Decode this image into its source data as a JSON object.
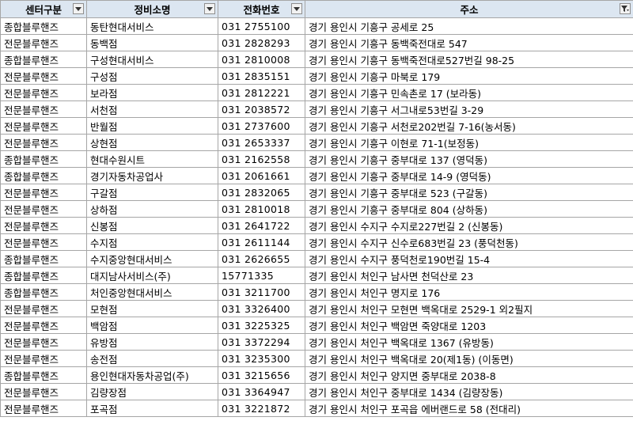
{
  "headers": [
    "센터구분",
    "정비소명",
    "전화번호",
    "주소"
  ],
  "header_filters": [
    "chevron-down-icon",
    "chevron-down-icon",
    "chevron-down-icon",
    "filter-active-icon"
  ],
  "rows": [
    [
      "종합블루핸즈",
      "동탄현대서비스",
      "031 2755100",
      "경기 용인시 기흥구 공세로 25"
    ],
    [
      "전문블루핸즈",
      "동백점",
      "031 2828293",
      "경기 용인시 기흥구 동백죽전대로 547"
    ],
    [
      "종합블루핸즈",
      "구성현대서비스",
      "031 2810008",
      "경기 용인시 기흥구 동백죽전대로527번길 98-25"
    ],
    [
      "전문블루핸즈",
      "구성점",
      "031 2835151",
      "경기 용인시 기흥구 마북로 179"
    ],
    [
      "전문블루핸즈",
      "보라점",
      "031 2812221",
      "경기 용인시 기흥구 민속촌로 17 (보라동)"
    ],
    [
      "전문블루핸즈",
      "서천점",
      "031 2038572",
      "경기 용인시 기흥구 서그내로53번길 3-29"
    ],
    [
      "전문블루핸즈",
      "반월점",
      "031 2737600",
      "경기 용인시 기흥구 서천로202번길 7-16(농서동)"
    ],
    [
      "전문블루핸즈",
      "상현점",
      "031 2653337",
      "경기 용인시 기흥구 이현로 71-1(보정동)"
    ],
    [
      "종합블루핸즈",
      "현대수원시트",
      "031 2162558",
      "경기 용인시 기흥구 중부대로 137 (영덕동)"
    ],
    [
      "종합블루핸즈",
      "경기자동차공업사",
      "031 2061661",
      "경기 용인시 기흥구 중부대로 14-9 (영덕동)"
    ],
    [
      "전문블루핸즈",
      "구갈점",
      "031 2832065",
      "경기 용인시 기흥구 중부대로 523 (구갈동)"
    ],
    [
      "전문블루핸즈",
      "상하점",
      "031 2810018",
      "경기 용인시 기흥구 중부대로 804 (상하동)"
    ],
    [
      "전문블루핸즈",
      "신봉점",
      "031 2641722",
      "경기 용인시 수지구 수지로227번길 2 (신봉동)"
    ],
    [
      "전문블루핸즈",
      "수지점",
      "031 2611144",
      "경기 용인시 수지구 신수로683번길 23 (풍덕천동)"
    ],
    [
      "종합블루핸즈",
      "수지중앙현대서비스",
      "031 2626655",
      "경기 용인시 수지구 풍덕천로190번길 15-4"
    ],
    [
      "종합블루핸즈",
      "대지남사서비스(주)",
      "15771335",
      "경기 용인시 처인구 남사면 천덕산로 23"
    ],
    [
      "종합블루핸즈",
      "처인중앙현대서비스",
      "031 3211700",
      "경기 용인시 처인구 명지로 176"
    ],
    [
      "전문블루핸즈",
      "모현점",
      "031 3326400",
      "경기 용인시 처인구 모현면 백옥대로 2529-1 외2필지"
    ],
    [
      "전문블루핸즈",
      "백암점",
      "031 3225325",
      "경기 용인시 처인구 백암면 죽양대로 1203"
    ],
    [
      "전문블루핸즈",
      "유방점",
      "031 3372294",
      "경기 용인시 처인구 백옥대로 1367 (유방동)"
    ],
    [
      "전문블루핸즈",
      "송전점",
      "031 3235300",
      "경기 용인시 처인구 백옥대로 20(제1동) (이동면)"
    ],
    [
      "종합블루핸즈",
      "용인현대자동차공업(주)",
      "031 3215656",
      "경기 용인시 처인구 양지면 중부대로 2038-8"
    ],
    [
      "전문블루핸즈",
      "김량장점",
      "031 3364947",
      "경기 용인시 처인구 중부대로 1434 (김량장동)"
    ],
    [
      "전문블루핸즈",
      "포곡점",
      "031 3221872",
      "경기 용인시 처인구 포곡읍 에버랜드로 58 (전대리)"
    ]
  ]
}
